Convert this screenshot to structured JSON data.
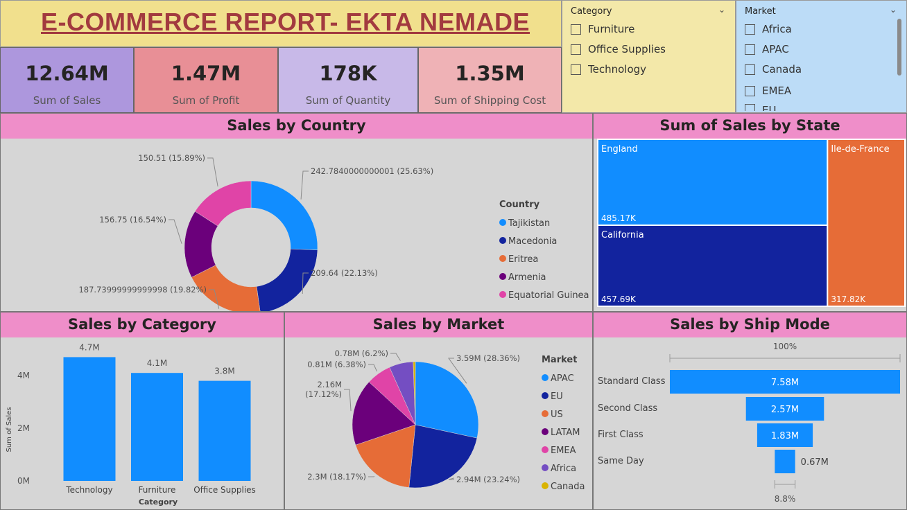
{
  "title": "E-COMMERCE REPORT- EKTA NEMADE",
  "kpis": [
    {
      "value": "12.64M",
      "label": "Sum of Sales",
      "bg": "#ad97dd"
    },
    {
      "value": "1.47M",
      "label": "Sum of Profit",
      "bg": "#e88f96"
    },
    {
      "value": "178K",
      "label": "Sum of Quantity",
      "bg": "#c8b9e8"
    },
    {
      "value": "1.35M",
      "label": "Sum of Shipping Cost",
      "bg": "#efb2b6"
    }
  ],
  "category_slicer": {
    "header": "Category",
    "items": [
      "Furniture",
      "Office Supplies",
      "Technology"
    ]
  },
  "market_slicer": {
    "header": "Market",
    "items": [
      "Africa",
      "APAC",
      "Canada",
      "EMEA",
      "EU"
    ]
  },
  "colors": {
    "blue": "#118dff",
    "navy": "#12239e",
    "orange": "#e66c37",
    "purple": "#6b007b",
    "pink": "#e044a7",
    "violet": "#744ec2",
    "gold": "#d9b300"
  },
  "panels": {
    "country": "Sales by Country",
    "state": "Sum of Sales by State",
    "category": "Sales by Category",
    "market": "Sales by Market",
    "shipmode": "Sales by Ship Mode"
  },
  "chart_data": [
    {
      "id": "country",
      "type": "donut",
      "title": "Sales by Country",
      "legend_title": "Country",
      "legend_position": "right",
      "slices": [
        {
          "name": "Tajikistan",
          "value": 242.784,
          "label": "242.7840000000001 (25.63%)",
          "color": "#118dff"
        },
        {
          "name": "Macedonia",
          "value": 209.64,
          "label": "209.64 (22.13%)",
          "color": "#12239e"
        },
        {
          "name": "Eritrea",
          "value": 187.74,
          "label": "187.73999999999998 (19.82%)",
          "color": "#e66c37"
        },
        {
          "name": "Armenia",
          "value": 156.75,
          "label": "156.75 (16.54%)",
          "color": "#6b007b"
        },
        {
          "name": "Equatorial Guinea",
          "value": 150.51,
          "label": "150.51 (15.89%)",
          "color": "#e044a7"
        }
      ]
    },
    {
      "id": "state",
      "type": "treemap",
      "title": "Sum of Sales by State",
      "items": [
        {
          "name": "England",
          "value": 485.17,
          "label": "485.17K",
          "color": "#118dff"
        },
        {
          "name": "California",
          "value": 457.69,
          "label": "457.69K",
          "color": "#12239e"
        },
        {
          "name": "Ile-de-France",
          "value": 317.82,
          "label": "317.82K",
          "color": "#e66c37"
        }
      ]
    },
    {
      "id": "category",
      "type": "bar",
      "title": "Sales by Category",
      "xlabel": "Category",
      "ylabel": "Sum of Sales",
      "ylim": [
        0,
        5
      ],
      "yticks": [
        "0M",
        "2M",
        "4M"
      ],
      "categories": [
        "Technology",
        "Furniture",
        "Office Supplies"
      ],
      "values": [
        4.7,
        4.1,
        3.8
      ],
      "value_labels": [
        "4.7M",
        "4.1M",
        "3.8M"
      ],
      "color": "#118dff"
    },
    {
      "id": "market",
      "type": "pie",
      "title": "Sales by Market",
      "legend_title": "Market",
      "legend_position": "right",
      "slices": [
        {
          "name": "APAC",
          "value": 3.59,
          "label": "3.59M (28.36%)",
          "color": "#118dff"
        },
        {
          "name": "EU",
          "value": 2.94,
          "label": "2.94M (23.24%)",
          "color": "#12239e"
        },
        {
          "name": "US",
          "value": 2.3,
          "label": "2.3M (18.17%)",
          "color": "#e66c37"
        },
        {
          "name": "LATAM",
          "value": 2.16,
          "label": "2.16M (17.12%)",
          "color": "#6b007b"
        },
        {
          "name": "EMEA",
          "value": 0.81,
          "label": "0.81M (6.38%)",
          "color": "#e044a7"
        },
        {
          "name": "Africa",
          "value": 0.78,
          "label": "0.78M (6.2%)",
          "color": "#744ec2"
        },
        {
          "name": "Canada",
          "value": 0.07,
          "label": "",
          "color": "#d9b300"
        }
      ]
    },
    {
      "id": "shipmode",
      "type": "funnel",
      "title": "Sales by Ship Mode",
      "top_label": "100%",
      "bottom_label": "8.8%",
      "stages": [
        {
          "name": "Standard Class",
          "value": 7.58,
          "label": "7.58M"
        },
        {
          "name": "Second Class",
          "value": 2.57,
          "label": "2.57M"
        },
        {
          "name": "First Class",
          "value": 1.83,
          "label": "1.83M"
        },
        {
          "name": "Same Day",
          "value": 0.67,
          "label": "0.67M"
        }
      ],
      "color": "#118dff"
    }
  ]
}
